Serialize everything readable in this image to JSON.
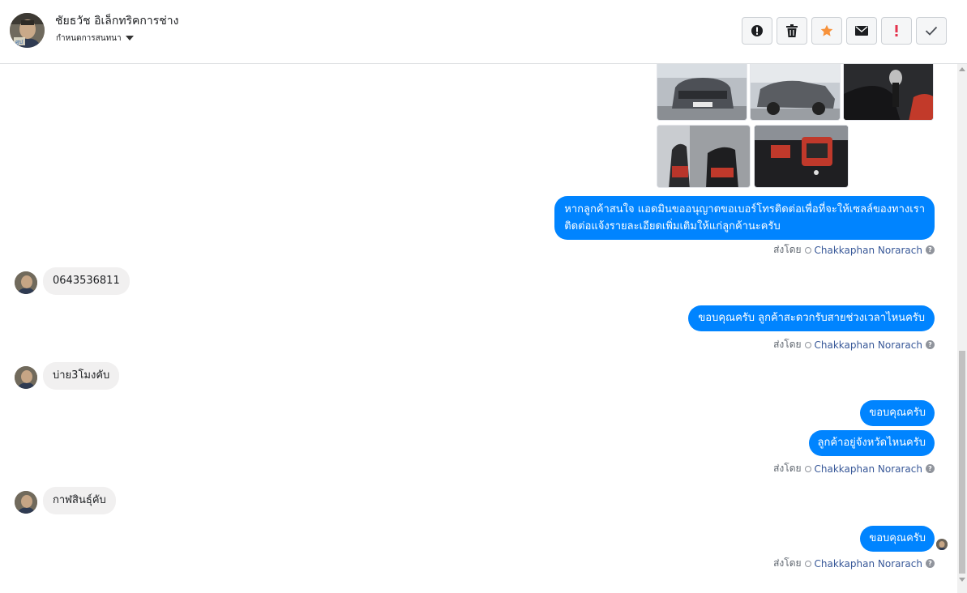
{
  "header": {
    "contact_name": "ชัยธวัช อิเล็กทริคการช่าง",
    "assign_label": "กำหนดการสนทนา",
    "actions": [
      {
        "icon": "alert-circle-icon",
        "name": "mark-spam-button"
      },
      {
        "icon": "trash-icon",
        "name": "delete-button"
      },
      {
        "icon": "star-icon",
        "name": "star-button"
      },
      {
        "icon": "envelope-icon",
        "name": "mark-unread-button"
      },
      {
        "icon": "exclamation-icon",
        "name": "follow-up-button"
      },
      {
        "icon": "check-icon",
        "name": "mark-done-button"
      }
    ],
    "colors": {
      "star": "#f7923b",
      "follow_up": "#e4334d"
    }
  },
  "thread": {
    "messages": [
      {
        "from": "page",
        "text": [
          "หากลูกค้าสนใจ แอดมินขออนุญาตขอเบอร์โทรติดต่อเพื่อที่จะให้เซลล์ของทางเรา",
          "ติดต่อแจ้งรายละเอียดเพิ่มเติมให้แก่ลูกค้านะครับ"
        ],
        "sent_by_label": "ส่งโดย",
        "sender": "Chakkaphan Norarach"
      },
      {
        "from": "customer",
        "text": "0643536811"
      },
      {
        "from": "page",
        "text": "ขอบคุณครับ ลูกค้าสะดวกรับสายช่วงเวลาไหนครับ",
        "sent_by_label": "ส่งโดย",
        "sender": "Chakkaphan Norarach"
      },
      {
        "from": "customer",
        "text": "บ่าย3โมงคับ"
      },
      {
        "from": "page",
        "text": "ขอบคุณครับ"
      },
      {
        "from": "page",
        "text": "ลูกค้าอยู่จังหวัดไหนครับ",
        "sent_by_label": "ส่งโดย",
        "sender": "Chakkaphan Norarach"
      },
      {
        "from": "customer",
        "text": "กาฬสินธุ์คับ"
      },
      {
        "from": "page",
        "text": "ขอบคุณครับ",
        "sent_by_label": "ส่งโดย",
        "sender": "Chakkaphan Norarach"
      }
    ],
    "bubble_color": "#0084ff"
  }
}
